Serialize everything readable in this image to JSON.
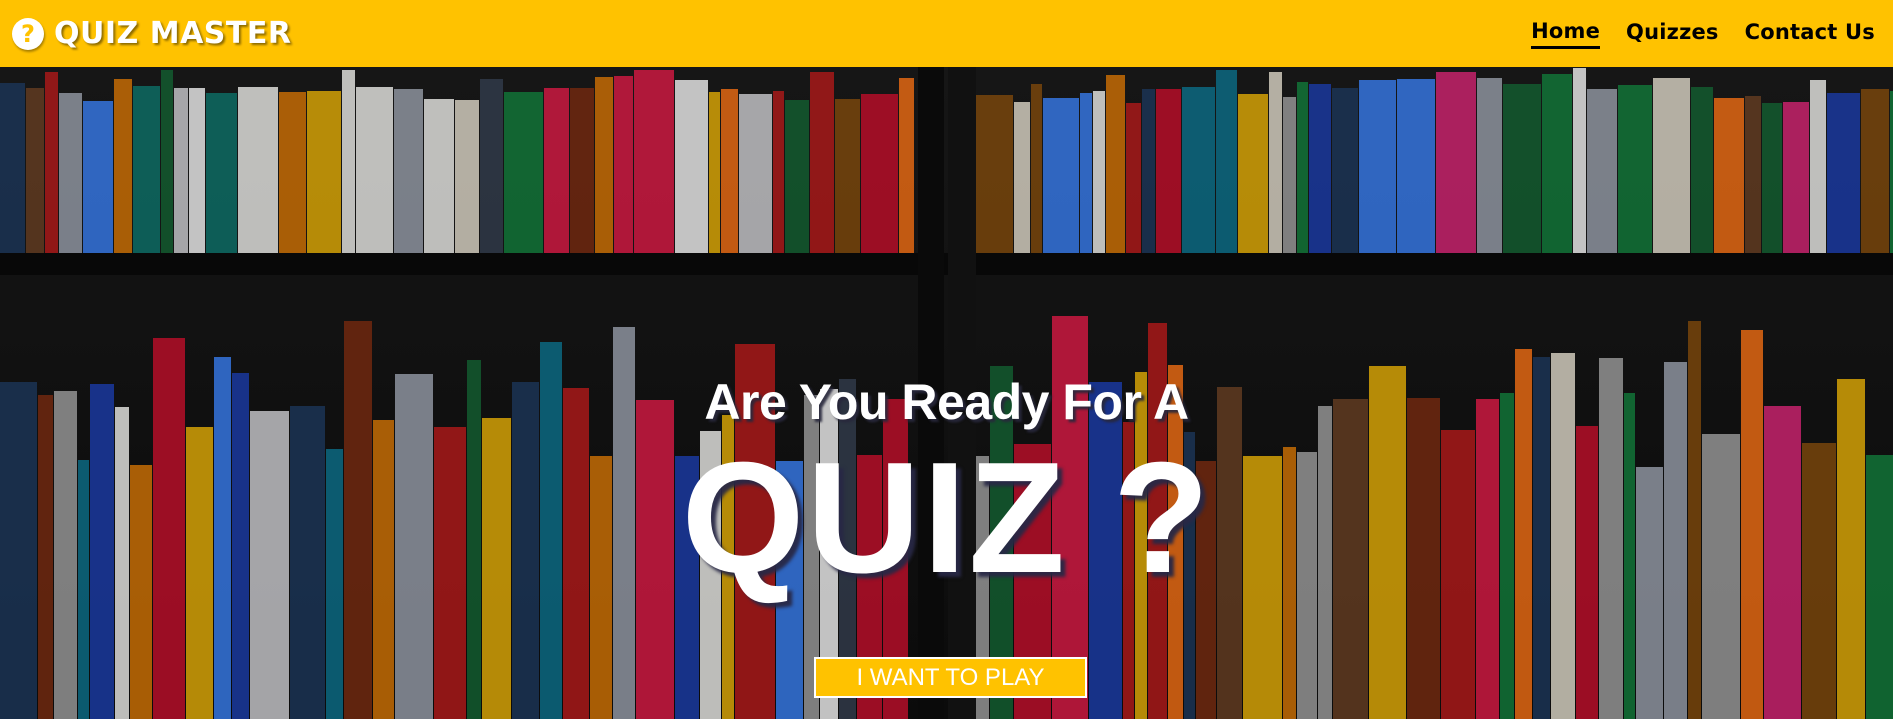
{
  "nav": {
    "brand_icon": "?",
    "brand_name": "QUIZ MASTER",
    "links": [
      "Home",
      "Quizzes",
      "Contact Us"
    ],
    "active": "Home"
  },
  "hero": {
    "subtitle": "Are You Ready For A",
    "title": "QUIZ ?",
    "button_label": "I WANT TO PLAY",
    "background": "bookshelf-photo"
  },
  "colors": {
    "accent": "#ffc200",
    "nav_text": "#000000",
    "hero_text": "#ffffff"
  }
}
